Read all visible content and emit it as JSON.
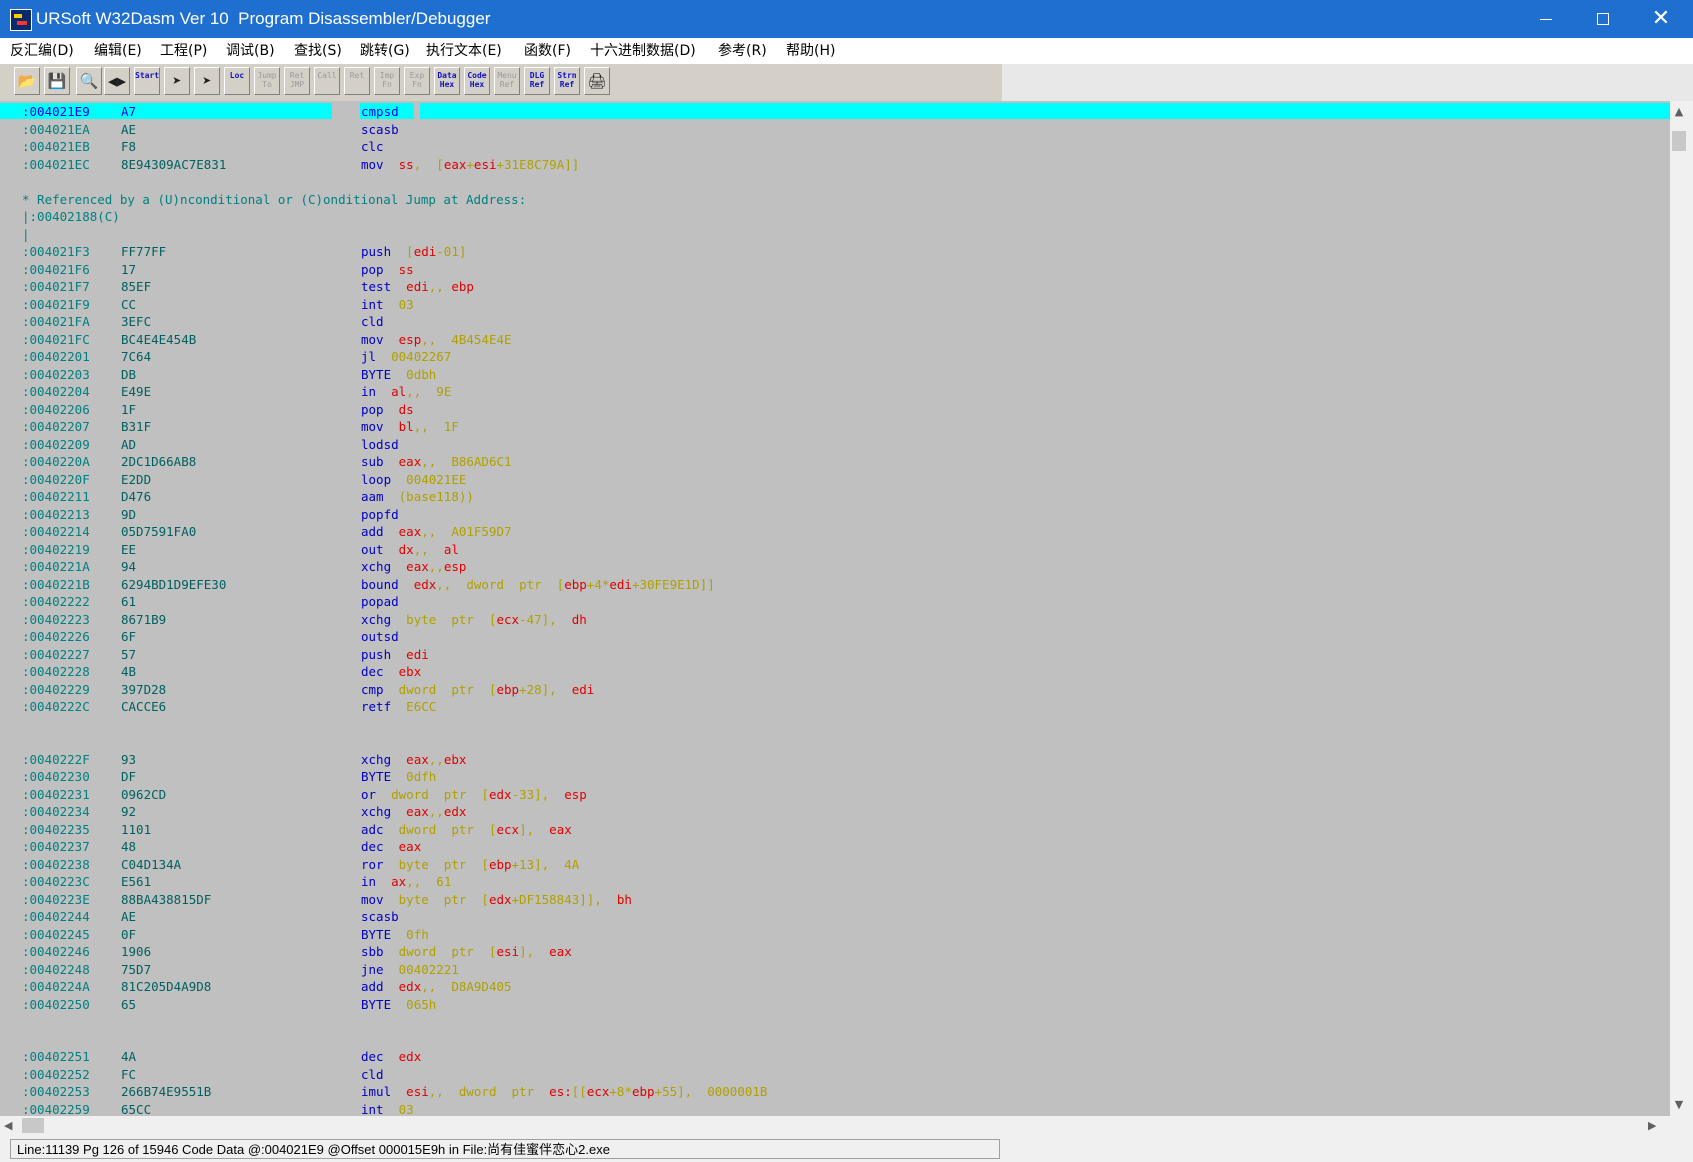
{
  "window": {
    "title": "URSoft W32Dasm Ver 10  Program Disassembler/Debugger",
    "close_symbol": "✕"
  },
  "menu": [
    "反汇编(D)",
    "编辑(E)",
    "工程(P)",
    "调试(B)",
    "查找(S)",
    "跳转(G)",
    "执行文本(E)",
    "函数(F)",
    "十六进制数据(D)",
    "参考(R)",
    "帮助(H)"
  ],
  "toolbar": [
    {
      "name": "open-file-icon",
      "label": "",
      "glyph": "📂",
      "state": "normal"
    },
    {
      "name": "save-project-icon",
      "label": "",
      "glyph": "💾",
      "state": "normal"
    },
    {
      "name": "find-icon",
      "label": "",
      "glyph": "🔍",
      "state": "normal"
    },
    {
      "name": "goto-code-icon",
      "label": "",
      "glyph": "◀▶",
      "state": "disabled"
    },
    {
      "name": "goto-start-icon",
      "label": "Start",
      "glyph": "",
      "state": "active"
    },
    {
      "name": "goto-location-icon",
      "label": "",
      "glyph": "➤",
      "state": "disabled"
    },
    {
      "name": "goto-program-entry-icon",
      "label": "",
      "glyph": "➤",
      "state": "normal"
    },
    {
      "name": "goto-code-loc-icon",
      "label": "Loc",
      "glyph": "",
      "state": "active"
    },
    {
      "name": "jump-to-icon",
      "label": "Jump To",
      "glyph": "",
      "state": "disabled"
    },
    {
      "name": "ret-jmp-icon",
      "label": "Ret JMP",
      "glyph": "",
      "state": "disabled"
    },
    {
      "name": "call-icon",
      "label": "Call",
      "glyph": "",
      "state": "disabled"
    },
    {
      "name": "ret-icon",
      "label": "Ret",
      "glyph": "",
      "state": "disabled"
    },
    {
      "name": "imp-fn-icon",
      "label": "Imp Fn",
      "glyph": "",
      "state": "disabled"
    },
    {
      "name": "exp-fn-icon",
      "label": "Exp Fn",
      "glyph": "",
      "state": "disabled"
    },
    {
      "name": "data-hex-icon",
      "label": "Data Hex",
      "glyph": "",
      "state": "active"
    },
    {
      "name": "code-hex-icon",
      "label": "Code Hex",
      "glyph": "",
      "state": "active"
    },
    {
      "name": "menu-ref-icon",
      "label": "Menu Ref",
      "glyph": "",
      "state": "disabled"
    },
    {
      "name": "dlg-ref-icon",
      "label": "DLG Ref",
      "glyph": "",
      "state": "active"
    },
    {
      "name": "strn-ref-icon",
      "label": "Strn Ref",
      "glyph": "",
      "state": "active"
    },
    {
      "name": "print-icon",
      "label": "",
      "glyph": "🖨",
      "state": "normal"
    }
  ],
  "code": [
    {
      "a": ":004021E9",
      "b": "A7",
      "m": "cmpsd",
      "o": [],
      "sel": true
    },
    {
      "a": ":004021EA",
      "b": "AE",
      "m": "scasb",
      "o": []
    },
    {
      "a": ":004021EB",
      "b": "F8",
      "m": "clc",
      "o": []
    },
    {
      "a": ":004021EC",
      "b": "8E94309AC7E831",
      "m": "mov",
      "o": [
        [
          "r",
          "ss"
        ],
        [
          "p",
          ",  ["
        ],
        [
          "r",
          "eax"
        ],
        [
          "p",
          "+"
        ],
        [
          "r",
          "esi"
        ],
        [
          "p",
          "+31E8C79A]]"
        ]
      ]
    },
    {
      "blank": true
    },
    {
      "c": "* Referenced by a (U)nconditional or (C)onditional Jump at Address:"
    },
    {
      "c": "|:00402188(C)"
    },
    {
      "c": "|"
    },
    {
      "a": ":004021F3",
      "b": "FF77FF",
      "m": "push",
      "o": [
        [
          "p",
          "["
        ],
        [
          "r",
          "edi"
        ],
        [
          "p",
          "-01]"
        ]
      ]
    },
    {
      "a": ":004021F6",
      "b": "17",
      "m": "pop",
      "o": [
        [
          "r",
          "ss"
        ]
      ]
    },
    {
      "a": ":004021F7",
      "b": "85EF",
      "m": "test",
      "o": [
        [
          "r",
          "edi"
        ],
        [
          "p",
          ",, "
        ],
        [
          "r",
          "ebp"
        ]
      ]
    },
    {
      "a": ":004021F9",
      "b": "CC",
      "m": "int",
      "o": [
        [
          "p",
          "03"
        ]
      ]
    },
    {
      "a": ":004021FA",
      "b": "3EFC",
      "m": "cld",
      "o": []
    },
    {
      "a": ":004021FC",
      "b": "BC4E4E454B",
      "m": "mov",
      "o": [
        [
          "r",
          "esp"
        ],
        [
          "p",
          ",,  4B454E4E"
        ]
      ]
    },
    {
      "a": ":00402201",
      "b": "7C64",
      "m": "jl",
      "o": [
        [
          "p",
          "00402267"
        ]
      ]
    },
    {
      "a": ":00402203",
      "b": "DB",
      "m": "BYTE",
      "o": [
        [
          "p",
          "0dbh"
        ]
      ]
    },
    {
      "a": ":00402204",
      "b": "E49E",
      "m": "in",
      "o": [
        [
          "r",
          "al"
        ],
        [
          "p",
          ",,  9E"
        ]
      ]
    },
    {
      "a": ":00402206",
      "b": "1F",
      "m": "pop",
      "o": [
        [
          "r",
          "ds"
        ]
      ]
    },
    {
      "a": ":00402207",
      "b": "B31F",
      "m": "mov",
      "o": [
        [
          "r",
          "bl"
        ],
        [
          "p",
          ",,  1F"
        ]
      ]
    },
    {
      "a": ":00402209",
      "b": "AD",
      "m": "lodsd",
      "o": []
    },
    {
      "a": ":0040220A",
      "b": "2DC1D66AB8",
      "m": "sub",
      "o": [
        [
          "r",
          "eax"
        ],
        [
          "p",
          ",,  B86AD6C1"
        ]
      ]
    },
    {
      "a": ":0040220F",
      "b": "E2DD",
      "m": "loop",
      "o": [
        [
          "p",
          "004021EE"
        ]
      ]
    },
    {
      "a": ":00402211",
      "b": "D476",
      "m": "aam",
      "o": [
        [
          "p",
          "(base118))"
        ]
      ]
    },
    {
      "a": ":00402213",
      "b": "9D",
      "m": "popfd",
      "o": []
    },
    {
      "a": ":00402214",
      "b": "05D7591FA0",
      "m": "add",
      "o": [
        [
          "r",
          "eax"
        ],
        [
          "p",
          ",,  A01F59D7"
        ]
      ]
    },
    {
      "a": ":00402219",
      "b": "EE",
      "m": "out",
      "o": [
        [
          "r",
          "dx"
        ],
        [
          "p",
          ",,  "
        ],
        [
          "r",
          "al"
        ]
      ]
    },
    {
      "a": ":0040221A",
      "b": "94",
      "m": "xchg",
      "o": [
        [
          "r",
          "eax"
        ],
        [
          "p",
          ",,"
        ],
        [
          "r",
          "esp"
        ]
      ]
    },
    {
      "a": ":0040221B",
      "b": "6294BD1D9EFE30",
      "m": "bound",
      "o": [
        [
          "r",
          "edx"
        ],
        [
          "p",
          ",,  dword  ptr  ["
        ],
        [
          "r",
          "ebp"
        ],
        [
          "p",
          "+4*"
        ],
        [
          "r",
          "edi"
        ],
        [
          "p",
          "+30FE9E1D]]"
        ]
      ]
    },
    {
      "a": ":00402222",
      "b": "61",
      "m": "popad",
      "o": []
    },
    {
      "a": ":00402223",
      "b": "8671B9",
      "m": "xchg",
      "o": [
        [
          "p",
          "byte  ptr  ["
        ],
        [
          "r",
          "ecx"
        ],
        [
          "p",
          "-47],  "
        ],
        [
          "r",
          "dh"
        ]
      ]
    },
    {
      "a": ":00402226",
      "b": "6F",
      "m": "outsd",
      "o": []
    },
    {
      "a": ":00402227",
      "b": "57",
      "m": "push",
      "o": [
        [
          "r",
          "edi"
        ]
      ]
    },
    {
      "a": ":00402228",
      "b": "4B",
      "m": "dec",
      "o": [
        [
          "r",
          "ebx"
        ]
      ]
    },
    {
      "a": ":00402229",
      "b": "397D28",
      "m": "cmp",
      "o": [
        [
          "p",
          "dword  ptr  ["
        ],
        [
          "r",
          "ebp"
        ],
        [
          "p",
          "+28],  "
        ],
        [
          "r",
          "edi"
        ]
      ]
    },
    {
      "a": ":0040222C",
      "b": "CACCE6",
      "m": "retf",
      "o": [
        [
          "p",
          "E6CC"
        ]
      ]
    },
    {
      "blank": true
    },
    {
      "blank": true
    },
    {
      "a": ":0040222F",
      "b": "93",
      "m": "xchg",
      "o": [
        [
          "r",
          "eax"
        ],
        [
          "p",
          ",,"
        ],
        [
          "r",
          "ebx"
        ]
      ]
    },
    {
      "a": ":00402230",
      "b": "DF",
      "m": "BYTE",
      "o": [
        [
          "p",
          "0dfh"
        ]
      ]
    },
    {
      "a": ":00402231",
      "b": "0962CD",
      "m": "or",
      "o": [
        [
          "p",
          "dword  ptr  ["
        ],
        [
          "r",
          "edx"
        ],
        [
          "p",
          "-33],  "
        ],
        [
          "r",
          "esp"
        ]
      ]
    },
    {
      "a": ":00402234",
      "b": "92",
      "m": "xchg",
      "o": [
        [
          "r",
          "eax"
        ],
        [
          "p",
          ",,"
        ],
        [
          "r",
          "edx"
        ]
      ]
    },
    {
      "a": ":00402235",
      "b": "1101",
      "m": "adc",
      "o": [
        [
          "p",
          "dword  ptr  ["
        ],
        [
          "r",
          "ecx"
        ],
        [
          "p",
          "],  "
        ],
        [
          "r",
          "eax"
        ]
      ]
    },
    {
      "a": ":00402237",
      "b": "48",
      "m": "dec",
      "o": [
        [
          "r",
          "eax"
        ]
      ]
    },
    {
      "a": ":00402238",
      "b": "C04D134A",
      "m": "ror",
      "o": [
        [
          "p",
          "byte  ptr  ["
        ],
        [
          "r",
          "ebp"
        ],
        [
          "p",
          "+13],  4A"
        ]
      ]
    },
    {
      "a": ":0040223C",
      "b": "E561",
      "m": "in",
      "o": [
        [
          "r",
          "ax"
        ],
        [
          "p",
          ",,  61"
        ]
      ]
    },
    {
      "a": ":0040223E",
      "b": "88BA438815DF",
      "m": "mov",
      "o": [
        [
          "p",
          "byte  ptr  ["
        ],
        [
          "r",
          "edx"
        ],
        [
          "p",
          "+DF158843]],  "
        ],
        [
          "r",
          "bh"
        ]
      ]
    },
    {
      "a": ":00402244",
      "b": "AE",
      "m": "scasb",
      "o": []
    },
    {
      "a": ":00402245",
      "b": "0F",
      "m": "BYTE",
      "o": [
        [
          "p",
          "0fh"
        ]
      ]
    },
    {
      "a": ":00402246",
      "b": "1906",
      "m": "sbb",
      "o": [
        [
          "p",
          "dword  ptr  ["
        ],
        [
          "r",
          "esi"
        ],
        [
          "p",
          "],  "
        ],
        [
          "r",
          "eax"
        ]
      ]
    },
    {
      "a": ":00402248",
      "b": "75D7",
      "m": "jne",
      "o": [
        [
          "p",
          "00402221"
        ]
      ]
    },
    {
      "a": ":0040224A",
      "b": "81C205D4A9D8",
      "m": "add",
      "o": [
        [
          "r",
          "edx"
        ],
        [
          "p",
          ",,  D8A9D405"
        ]
      ]
    },
    {
      "a": ":00402250",
      "b": "65",
      "m": "BYTE",
      "o": [
        [
          "p",
          "065h"
        ]
      ]
    },
    {
      "blank": true
    },
    {
      "blank": true
    },
    {
      "a": ":00402251",
      "b": "4A",
      "m": "dec",
      "o": [
        [
          "r",
          "edx"
        ]
      ]
    },
    {
      "a": ":00402252",
      "b": "FC",
      "m": "cld",
      "o": []
    },
    {
      "a": ":00402253",
      "b": "266B74E9551B",
      "m": "imul",
      "o": [
        [
          "r",
          "esi"
        ],
        [
          "p",
          ",,  dword  ptr  "
        ],
        [
          "r",
          "es:"
        ],
        [
          "p",
          "[["
        ],
        [
          "r",
          "ecx"
        ],
        [
          "p",
          "+8*"
        ],
        [
          "r",
          "ebp"
        ],
        [
          "p",
          "+55],  0000001B"
        ]
      ]
    },
    {
      "a": ":00402259",
      "b": "65CC",
      "m": "int",
      "o": [
        [
          "p",
          "03"
        ]
      ]
    }
  ],
  "scroll": {
    "up": "▲",
    "down": "▼",
    "left": "◀",
    "right": "▶"
  },
  "status": "Line:11139 Pg 126 of 15946  Code Data @:004021E9 @Offset 000015E9h in File:尚有佳蜜伴恋心2.exe"
}
